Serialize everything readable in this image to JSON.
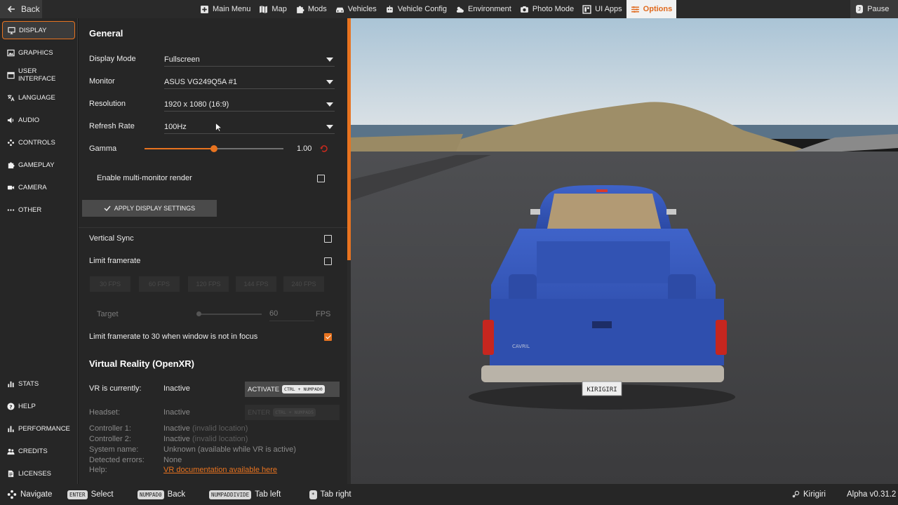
{
  "topbar": {
    "back_label": "Back",
    "tabs": [
      {
        "label": "Main Menu",
        "icon": "grid-icon"
      },
      {
        "label": "Map",
        "icon": "map-icon"
      },
      {
        "label": "Mods",
        "icon": "puzzle-icon"
      },
      {
        "label": "Vehicles",
        "icon": "car-icon"
      },
      {
        "label": "Vehicle Config",
        "icon": "robot-icon"
      },
      {
        "label": "Environment",
        "icon": "weather-icon"
      },
      {
        "label": "Photo Mode",
        "icon": "camera-icon"
      },
      {
        "label": "UI Apps",
        "icon": "apps-icon"
      },
      {
        "label": "Options",
        "icon": "sliders-icon",
        "active": true
      }
    ],
    "pause_key": "J",
    "pause_label": "Pause"
  },
  "sidebar": {
    "top_items": [
      {
        "label": "DISPLAY",
        "icon": "monitor-icon",
        "active": true
      },
      {
        "label": "GRAPHICS",
        "icon": "image-icon"
      },
      {
        "label": "USER INTERFACE",
        "icon": "window-icon"
      },
      {
        "label": "LANGUAGE",
        "icon": "translate-icon"
      },
      {
        "label": "AUDIO",
        "icon": "speaker-icon"
      },
      {
        "label": "CONTROLS",
        "icon": "gamepad-icon"
      },
      {
        "label": "GAMEPLAY",
        "icon": "puzzle-icon"
      },
      {
        "label": "CAMERA",
        "icon": "video-camera-icon"
      },
      {
        "label": "OTHER",
        "icon": "dots-icon"
      }
    ],
    "bottom_items": [
      {
        "label": "STATS",
        "icon": "bar-chart-icon"
      },
      {
        "label": "HELP",
        "icon": "help-icon"
      },
      {
        "label": "PERFORMANCE",
        "icon": "performance-icon"
      },
      {
        "label": "CREDITS",
        "icon": "people-icon"
      },
      {
        "label": "LICENSES",
        "icon": "document-icon"
      }
    ]
  },
  "general": {
    "title": "General",
    "display_mode": {
      "label": "Display Mode",
      "value": "Fullscreen"
    },
    "monitor": {
      "label": "Monitor",
      "value": "ASUS VG249Q5A #1"
    },
    "resolution": {
      "label": "Resolution",
      "value": "1920 x 1080 (16:9)"
    },
    "refresh_rate": {
      "label": "Refresh Rate",
      "value": "100Hz"
    },
    "gamma": {
      "label": "Gamma",
      "value": "1.00",
      "fraction": 0.5
    },
    "multi_monitor": {
      "label": "Enable multi-monitor render",
      "checked": false
    },
    "apply_label": "APPLY DISPLAY SETTINGS",
    "vsync": {
      "label": "Vertical Sync",
      "checked": false
    },
    "limit_framerate": {
      "label": "Limit framerate",
      "checked": false
    },
    "fps_presets": [
      "30 FPS",
      "60 FPS",
      "120 FPS",
      "144 FPS",
      "240 FPS"
    ],
    "target": {
      "label": "Target",
      "value": "60",
      "unit": "FPS",
      "fraction": 0.0
    },
    "limit_unfocused": {
      "label": "Limit framerate to 30 when window is not in focus",
      "checked": true
    }
  },
  "vr": {
    "title": "Virtual Reality (OpenXR)",
    "status_label": "VR is currently:",
    "status_value": "Inactive",
    "activate_label": "ACTIVATE",
    "activate_key": "CTRL + NUMPAD0",
    "headset_label": "Headset:",
    "headset_value": "Inactive",
    "enter_label": "ENTER",
    "enter_key": "CTRL + NUMPAD5",
    "controller1_label": "Controller 1:",
    "controller1_value": "Inactive",
    "controller1_note": "(invalid location)",
    "controller2_label": "Controller 2:",
    "controller2_value": "Inactive",
    "controller2_note": "(invalid location)",
    "system_label": "System name:",
    "system_value": "Unknown (available while VR is active)",
    "errors_label": "Detected errors:",
    "errors_value": "None",
    "help_label": "Help:",
    "help_link": "VR documentation available here"
  },
  "scene": {
    "plate": "KIRIGIRI",
    "badge": "CAVRIL"
  },
  "bottombar": {
    "navigate_label": "Navigate",
    "select_key": "ENTER",
    "select_label": "Select",
    "back_key": "NUMPAD0",
    "back_label": "Back",
    "tableft_key": "NUMPADDIVIDE",
    "tableft_label": "Tab left",
    "tabright_key": "*",
    "tabright_label": "Tab right",
    "user": "Kirigiri",
    "version": "Alpha v0.31.2"
  }
}
